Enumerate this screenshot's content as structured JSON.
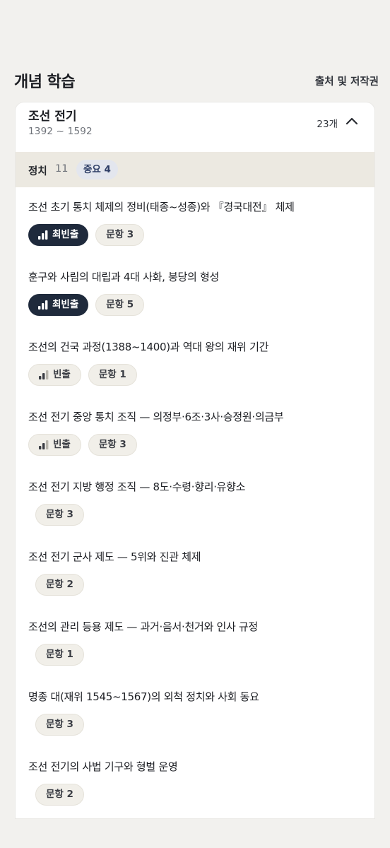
{
  "header": {
    "title": "개념 학습",
    "source_link": "출처 및 저작권"
  },
  "period": {
    "title": "조선 전기",
    "range": "1392 ~ 1592",
    "count": "23개"
  },
  "section": {
    "name": "정치",
    "count": "11",
    "important": "중요 4"
  },
  "colors": {
    "background": "#f2f1ee",
    "hot_badge": "#1f2a3c",
    "section_bar": "#ece9e1"
  },
  "topics": [
    {
      "title": "조선 초기 통치 체제의 정비(태종~성종)와 『경국대전』 체제",
      "freq": "최빈출",
      "freq_level": "hot",
      "questions": "문항 3"
    },
    {
      "title": "훈구와 사림의 대립과 4대 사화, 붕당의 형성",
      "freq": "최빈출",
      "freq_level": "hot",
      "questions": "문항 5"
    },
    {
      "title": "조선의 건국 과정(1388~1400)과 역대 왕의 재위 기간",
      "freq": "빈출",
      "freq_level": "frequent",
      "questions": "문항 1"
    },
    {
      "title": "조선 전기 중앙 통치 조직 — 의정부·6조·3사·승정원·의금부",
      "freq": "빈출",
      "freq_level": "frequent",
      "questions": "문항 3"
    },
    {
      "title": "조선 전기 지방 행정 조직 — 8도·수령·향리·유향소",
      "freq": "",
      "freq_level": "none",
      "questions": "문항 3"
    },
    {
      "title": "조선 전기 군사 제도 — 5위와 진관 체제",
      "freq": "",
      "freq_level": "none",
      "questions": "문항 2"
    },
    {
      "title": "조선의 관리 등용 제도 — 과거·음서·천거와 인사 규정",
      "freq": "",
      "freq_level": "none",
      "questions": "문항 1"
    },
    {
      "title": "명종 대(재위 1545~1567)의 외척 정치와 사회 동요",
      "freq": "",
      "freq_level": "none",
      "questions": "문항 3"
    },
    {
      "title": "조선 전기의 사법 기구와 형벌 운영",
      "freq": "",
      "freq_level": "none",
      "questions": "문항 2"
    }
  ]
}
